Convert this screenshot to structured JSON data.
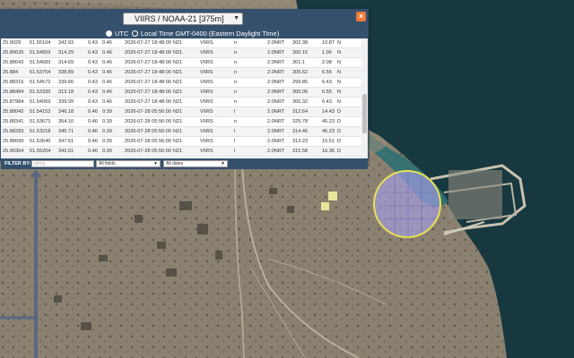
{
  "panel": {
    "satellite_select": "VIIRS / NOAA-21 [375m]",
    "close_label": "×",
    "time_options": {
      "utc": "UTC",
      "local": "Local Time GMT-0400 (Eastern Daylight Time)"
    },
    "rows": [
      [
        "25.9029",
        "51.55104",
        "342.93",
        "0.43",
        "0.46",
        "2026-07-27 18:48:00",
        "N21",
        "VIIRS",
        "n",
        "2.0NRT",
        "302.38",
        "10.87",
        "N"
      ],
      [
        "25.89635",
        "51.54659",
        "314.29",
        "0.43",
        "0.46",
        "2026-07-27 18:48:00",
        "N21",
        "VIIRS",
        "n",
        "2.0NRT",
        "300.15",
        "1.06",
        "N"
      ],
      [
        "25.88643",
        "51.54683",
        "314.69",
        "0.43",
        "0.46",
        "2026-07-27 18:48:00",
        "N21",
        "VIIRS",
        "n",
        "2.0NRT",
        "301.1",
        "2.08",
        "N"
      ],
      [
        "25.884",
        "51.53754",
        "338.89",
        "0.43",
        "0.46",
        "2026-07-27 18:48:00",
        "N21",
        "VIIRS",
        "n",
        "2.0NRT",
        "305.62",
        "6.55",
        "N"
      ],
      [
        "25.88316",
        "51.54572",
        "339.66",
        "0.43",
        "0.46",
        "2026-07-27 18:48:00",
        "N21",
        "VIIRS",
        "n",
        "2.0NRT",
        "299.85",
        "6.43",
        "N"
      ],
      [
        "25.88484",
        "51.53335",
        "313.18",
        "0.43",
        "0.46",
        "2026-07-27 18:48:00",
        "N21",
        "VIIRS",
        "n",
        "2.0NRT",
        "300.06",
        "6.55",
        "N"
      ],
      [
        "25.87984",
        "51.54069",
        "339.99",
        "0.43",
        "0.46",
        "2026-07-27 18:48:00",
        "N21",
        "VIIRS",
        "n",
        "2.0NRT",
        "300.32",
        "6.43",
        "N"
      ],
      [
        "25.88042",
        "51.54153",
        "346.18",
        "0.46",
        "0.39",
        "2026-07-28 05:56:00",
        "N21",
        "VIIRS",
        "l",
        "2.0NRT",
        "312.64",
        "14.43",
        "D"
      ],
      [
        "25.88341",
        "51.53673",
        "354.10",
        "0.46",
        "0.39",
        "2026-07-28 05:56:00",
        "N21",
        "VIIRS",
        "n",
        "2.0NRT",
        "325.78",
        "45.23",
        "D"
      ],
      [
        "25.88283",
        "51.53218",
        "345.71",
        "0.46",
        "0.39",
        "2026-07-28 05:56:00",
        "N21",
        "VIIRS",
        "l",
        "2.0NRT",
        "314.45",
        "45.23",
        "D"
      ],
      [
        "25.88699",
        "51.53646",
        "347.61",
        "0.46",
        "0.39",
        "2026-07-28 05:56:00",
        "N21",
        "VIIRS",
        "l",
        "2.0NRT",
        "313.23",
        "15.51",
        "D"
      ],
      [
        "25.90364",
        "51.55204",
        "342.01",
        "0.46",
        "0.39",
        "2026-07-28 05:56:00",
        "N21",
        "VIIRS",
        "l",
        "2.0NRT",
        "315.58",
        "16.36",
        "D"
      ]
    ],
    "filter": {
      "label": "FILTER BY:",
      "input_placeholder": "string",
      "fields_select": "All fields",
      "dates_select": "All dates"
    }
  },
  "colors": {
    "panel_header": "#35506d",
    "close_button": "#f07a38",
    "fire_area_fill": "#a5a0e8",
    "fire_area_stroke": "#e8e054",
    "fire_pixel": "#f5f0a0"
  },
  "icons": {
    "close": "close-icon",
    "dropdown": "chevron-down-icon"
  }
}
